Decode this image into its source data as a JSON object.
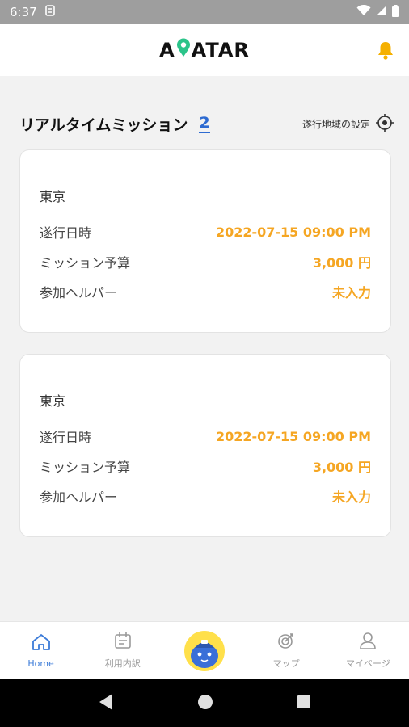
{
  "status_bar": {
    "time": "6:37"
  },
  "header": {
    "logo_text": "AVATAR"
  },
  "section": {
    "title": "リアルタイムミッション",
    "count": "2",
    "region_setting": "遂行地域の設定"
  },
  "missions": [
    {
      "city": "東京",
      "date_label": "遂行日時",
      "date_value": "2022-07-15 09:00 PM",
      "budget_label": "ミッション予算",
      "budget_value": "3,000 円",
      "helper_label": "参加ヘルパー",
      "helper_value": "未入力"
    },
    {
      "city": "東京",
      "date_label": "遂行日時",
      "date_value": "2022-07-15 09:00 PM",
      "budget_label": "ミッション予算",
      "budget_value": "3,000 円",
      "helper_label": "参加ヘルパー",
      "helper_value": "未入力"
    }
  ],
  "bottom_nav": {
    "home": "Home",
    "history": "利用内訳",
    "map": "マップ",
    "mypage": "マイページ"
  },
  "colors": {
    "accent": "#f5a623",
    "active": "#3b7bd8",
    "logo_pin": "#2bc48a",
    "bell": "#f5b000",
    "mascot_bg": "#ffe04a"
  },
  "icons": [
    "home-icon",
    "calendar-icon",
    "target-icon",
    "person-icon",
    "bell-icon",
    "gps-target-icon",
    "back-icon",
    "home-circle-icon",
    "recents-icon"
  ]
}
